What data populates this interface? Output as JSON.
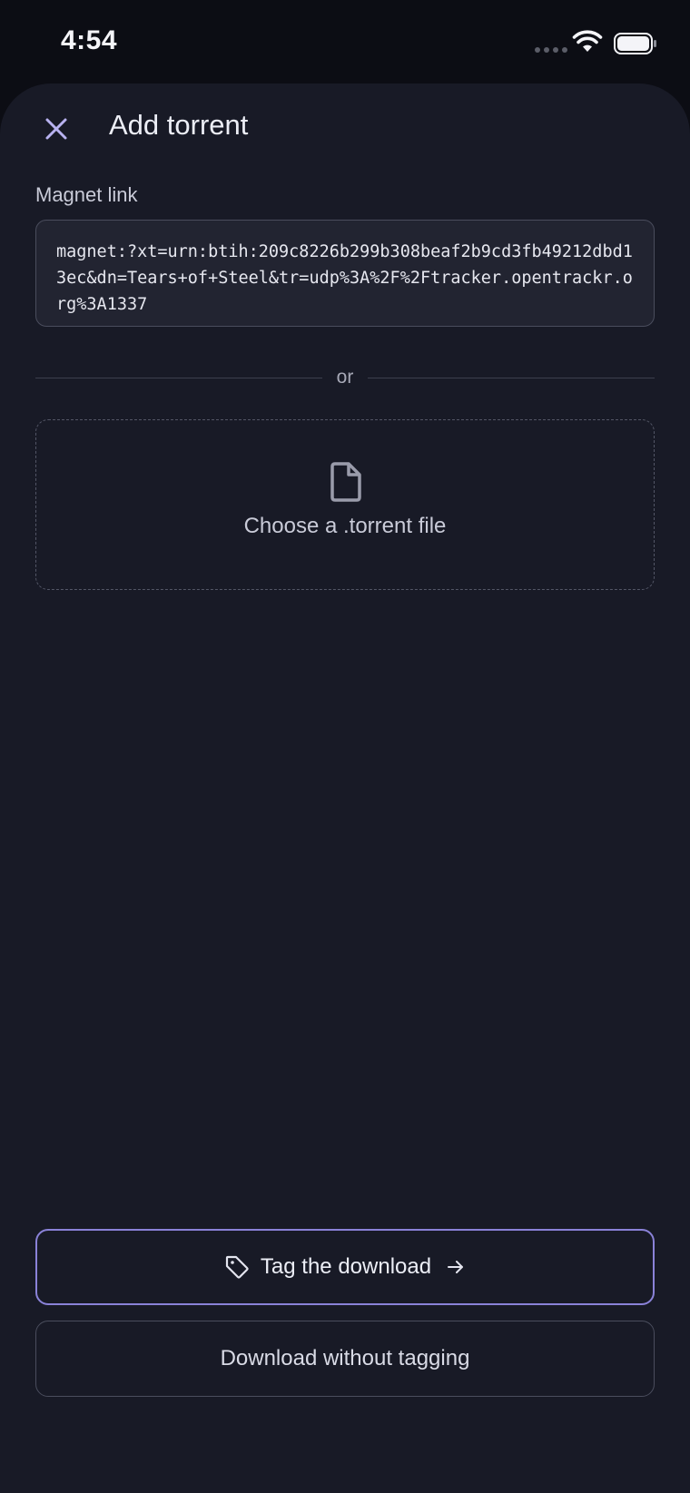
{
  "status_bar": {
    "time": "4:54",
    "wifi_icon": "wifi-icon",
    "battery_icon": "battery-icon"
  },
  "sheet": {
    "title": "Add torrent",
    "close_icon": "close-icon"
  },
  "magnet": {
    "label": "Magnet link",
    "value": "magnet:?xt=urn:btih:209c8226b299b308beaf2b9cd3fb49212dbd13ec&dn=Tears+of+Steel&tr=udp%3A%2F%2Ftracker.opentrackr.org%3A1337"
  },
  "divider": {
    "text": "or"
  },
  "file_chooser": {
    "label": "Choose a .torrent file",
    "icon": "file-icon"
  },
  "actions": {
    "tag_label": "Tag the download",
    "tag_icon": "tag-icon",
    "arrow_icon": "arrow-right-icon",
    "no_tag_label": "Download without tagging"
  },
  "colors": {
    "background": "#181a26",
    "accent": "#8a82d8",
    "border": "#4a4d5d"
  }
}
